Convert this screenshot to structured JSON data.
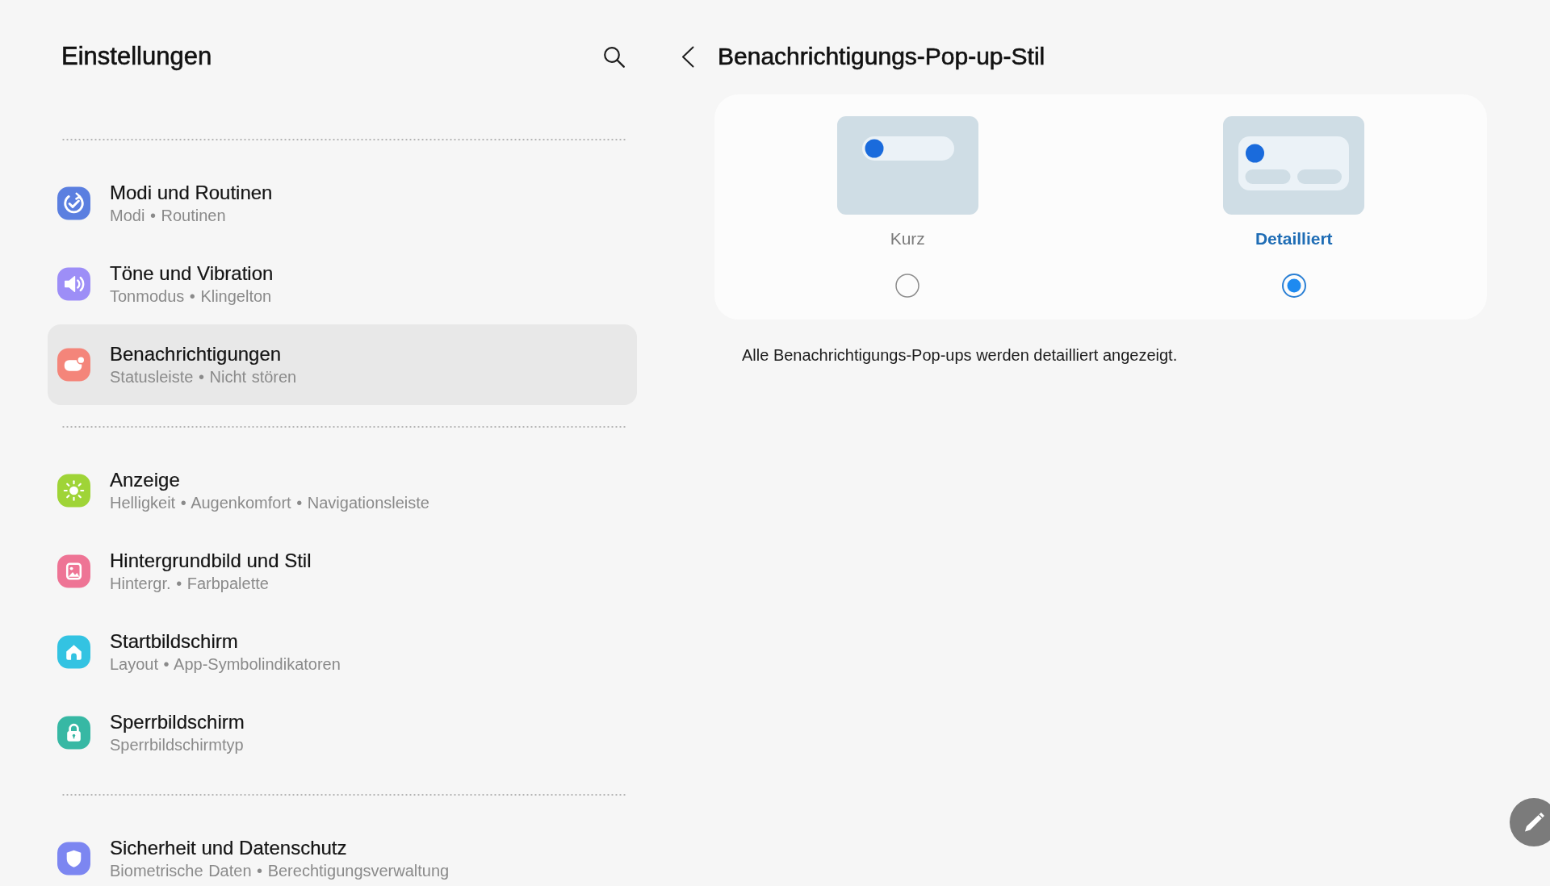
{
  "sidebar": {
    "title": "Einstellungen",
    "groups": [
      {
        "items": [
          {
            "title": "Modi und Routinen",
            "subtitle": "Modi • Routinen",
            "color": "#5b7fe0",
            "selected": false
          },
          {
            "title": "Töne und Vibration",
            "subtitle": "Tonmodus • Klingelton",
            "color": "#9d8ef7",
            "selected": false
          },
          {
            "title": "Benachrichtigungen",
            "subtitle": "Statusleiste • Nicht stören",
            "color": "#f4857a",
            "selected": true
          }
        ]
      },
      {
        "items": [
          {
            "title": "Anzeige",
            "subtitle": "Helligkeit • Augenkomfort • Navigationsleiste",
            "color": "#9fd437",
            "selected": false
          },
          {
            "title": "Hintergrundbild und Stil",
            "subtitle": "Hintergr. • Farbpalette",
            "color": "#ee7495",
            "selected": false
          },
          {
            "title": "Startbildschirm",
            "subtitle": "Layout • App-Symbolindikatoren",
            "color": "#33c3e2",
            "selected": false
          },
          {
            "title": "Sperrbildschirm",
            "subtitle": "Sperrbildschirmtyp",
            "color": "#37b8a4",
            "selected": false
          }
        ]
      },
      {
        "items": [
          {
            "title": "Sicherheit und Datenschutz",
            "subtitle": "Biometrische Daten • Berechtigungsverwaltung",
            "color": "#7c86f1",
            "selected": false
          }
        ]
      }
    ]
  },
  "detail": {
    "title": "Benachrichtigungs-Pop-up-Stil",
    "options": [
      {
        "kind": "brief",
        "label": "Kurz",
        "selected": false
      },
      {
        "kind": "detailed",
        "label": "Detailliert",
        "selected": true
      }
    ],
    "description": "Alle Benachrichtigungs-Pop-ups werden detailliert angezeigt."
  }
}
